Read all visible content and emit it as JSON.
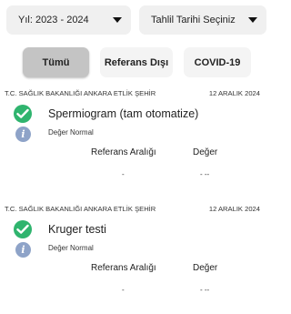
{
  "filters": {
    "year_label": "Yıl: 2023 - 2024",
    "date_label": "Tahlil Tarihi Seçiniz"
  },
  "chips": {
    "all": "Tümü",
    "out_of_reference": "Referans Dışı",
    "covid": "COVID-19",
    "active": "all"
  },
  "results": [
    {
      "hospital": "T.C. SAĞLIK BAKANLIĞI ANKARA ETLİK ŞEHİR",
      "date": "12 ARALIK 2024",
      "test_name": "Spermiogram (tam otomatize)",
      "status": "Değer Normal",
      "ref_header": "Referans Aralığı",
      "value_header": "Değer",
      "ref_value": "-",
      "value": "- --"
    },
    {
      "hospital": "T.C. SAĞLIK BAKANLIĞI ANKARA ETLİK ŞEHİR",
      "date": "12 ARALIK 2024",
      "test_name": "Kruger testi",
      "status": "Değer Normal",
      "ref_header": "Referans Aralığı",
      "value_header": "Değer",
      "ref_value": "-",
      "value": "- --"
    }
  ],
  "colors": {
    "check": "#2fb46e",
    "info": "#8ea3c8",
    "chip_active": "#c4c4c4"
  }
}
